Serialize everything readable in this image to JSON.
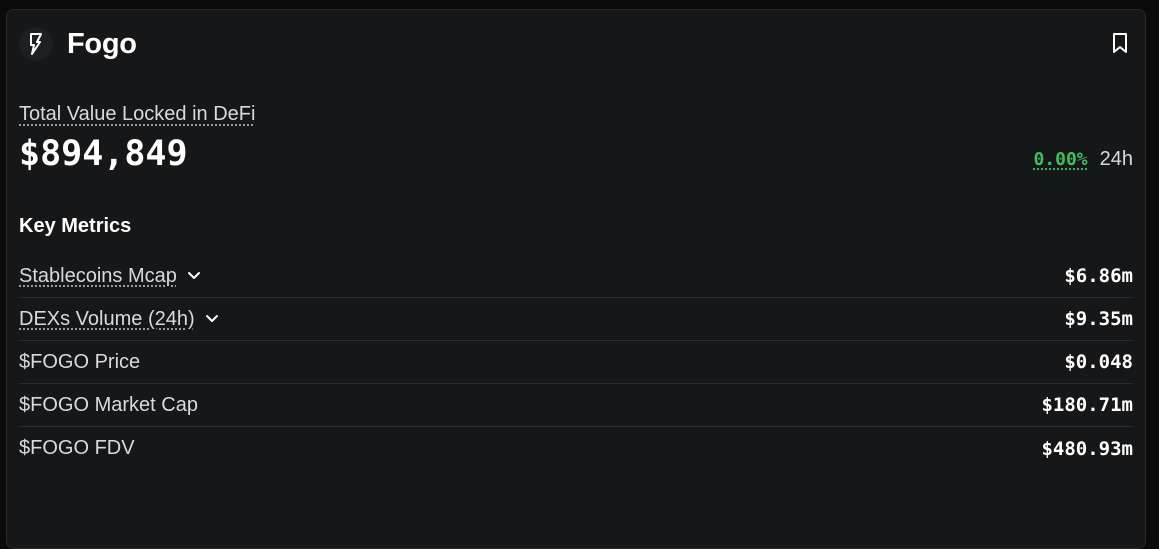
{
  "header": {
    "title": "Fogo",
    "logo_icon": "bolt-icon",
    "bookmark_icon": "bookmark-icon"
  },
  "tvl": {
    "label": "Total Value Locked in DeFi",
    "value": "$894,849",
    "change_pct": "0.00%",
    "change_period": "24h",
    "change_color": "#3fbe5f"
  },
  "metrics": {
    "title": "Key Metrics",
    "rows": [
      {
        "label": "Stablecoins Mcap",
        "value": "$6.86m",
        "expandable": true
      },
      {
        "label": "DEXs Volume (24h)",
        "value": "$9.35m",
        "expandable": true
      },
      {
        "label": "$FOGO Price",
        "value": "$0.048",
        "expandable": false
      },
      {
        "label": "$FOGO Market Cap",
        "value": "$180.71m",
        "expandable": false
      },
      {
        "label": "$FOGO FDV",
        "value": "$480.93m",
        "expandable": false
      }
    ]
  }
}
